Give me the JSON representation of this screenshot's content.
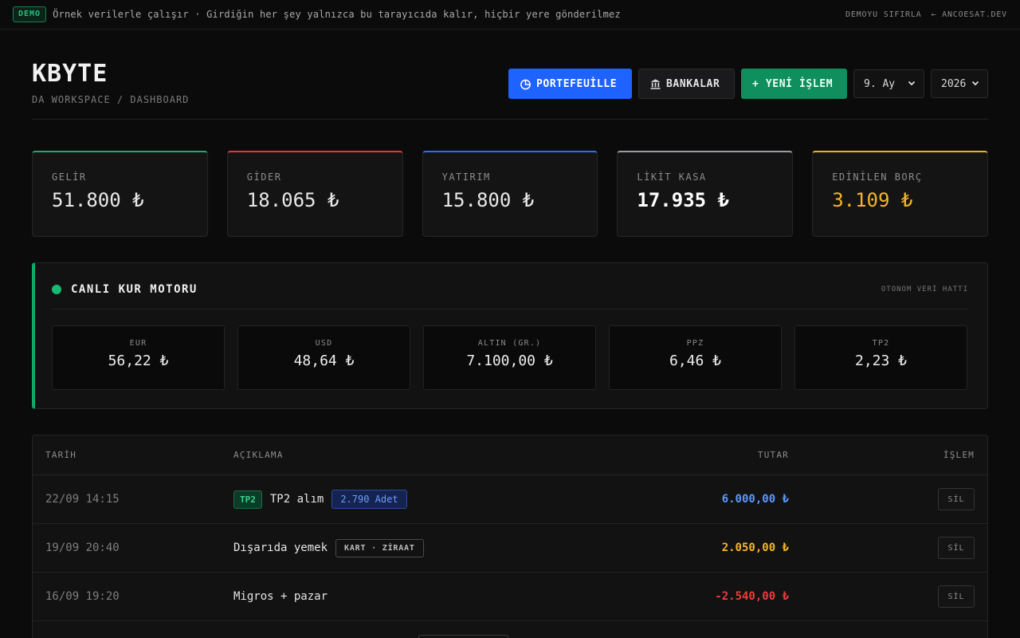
{
  "banner": {
    "badge": "DEMO",
    "text": "Örnek verilerle çalışır · Girdiğin her şey yalnızca bu tarayıcıda kalır, hiçbir yere gönderilmez",
    "reset": "DEMOYU SIFIRLA",
    "back": "← ANCOESAT.DEV"
  },
  "header": {
    "brand": "KBYTE",
    "breadcrumb": "DA WORKSPACE / DASHBOARD",
    "portfolio_label": "PORTEFEUİLLE",
    "banks_label": "BANKALAR",
    "new_tx_label": "+ YENİ İŞLEM",
    "month_value": "9. Ay",
    "year_value": "2026"
  },
  "stats": [
    {
      "label": "GELİR",
      "value": "51.800 ₺",
      "color": "#1fa86d"
    },
    {
      "label": "GİDER",
      "value": "18.065 ₺",
      "color": "#e0383d"
    },
    {
      "label": "YATIRIM",
      "value": "15.800 ₺",
      "color": "#2d6ff0"
    },
    {
      "label": "LİKİT KASA",
      "value": "17.935 ₺",
      "color": "#9a9ca1"
    },
    {
      "label": "EDİNİLEN BORÇ",
      "value": "3.109 ₺",
      "color": "#f0ac22"
    }
  ],
  "rates": {
    "title": "CANLI KUR MOTORU",
    "subtitle": "OTONOM VERİ HATTI",
    "items": [
      {
        "code": "EUR",
        "value": "56,22 ₺"
      },
      {
        "code": "USD",
        "value": "48,64 ₺"
      },
      {
        "code": "ALTIN (GR.)",
        "value": "7.100,00 ₺"
      },
      {
        "code": "PPZ",
        "value": "6,46 ₺"
      },
      {
        "code": "TP2",
        "value": "2,23 ₺"
      }
    ]
  },
  "table": {
    "headers": {
      "date": "TARİH",
      "desc": "AÇIKLAMA",
      "amount": "TUTAR",
      "action": "İŞLEM"
    },
    "rows": [
      {
        "date": "22/09 14:15",
        "tag": "TP2",
        "desc": "TP2 alım",
        "qty": "2.790 Adet",
        "card": "",
        "amount": "6.000,00 ₺",
        "amount_color": "#5d97ff",
        "action": "SİL"
      },
      {
        "date": "19/09 20:40",
        "tag": "",
        "desc": "Dışarıda yemek",
        "qty": "",
        "card": "KART · ZİRAAT",
        "amount": "2.050,00 ₺",
        "amount_color": "#f4b52a",
        "action": "SİL"
      },
      {
        "date": "16/09 19:20",
        "tag": "",
        "desc": "Migros + pazar",
        "qty": "",
        "card": "",
        "amount": "-2.540,00 ₺",
        "amount_color": "#ef3b3b",
        "action": "SİL"
      }
    ]
  }
}
